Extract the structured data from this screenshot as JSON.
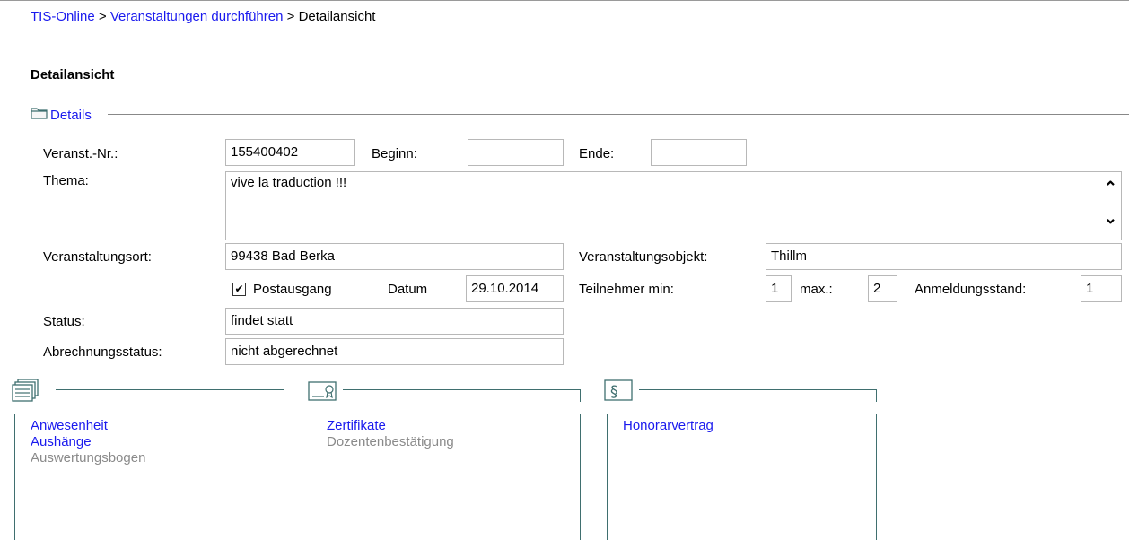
{
  "breadcrumb": {
    "items": [
      {
        "label": "TIS-Online",
        "link": true
      },
      {
        "label": "Veranstaltungen durchführen",
        "link": true
      },
      {
        "label": "Detailansicht",
        "link": false
      }
    ],
    "separator": " > "
  },
  "page": {
    "title": "Detailansicht"
  },
  "details": {
    "legend": "Details",
    "labels": {
      "nr": "Veranst.-Nr.:",
      "beginn": "Beginn:",
      "ende": "Ende:",
      "thema": "Thema:",
      "ort": "Veranstaltungsort:",
      "objekt": "Veranstaltungsobjekt:",
      "postausgang": "Postausgang",
      "datum": "Datum",
      "teilnehmer_min": "Teilnehmer min:",
      "max": "max.:",
      "anmeldungsstand": "Anmeldungsstand:",
      "status": "Status:",
      "abrechnungsstatus": "Abrechnungsstatus:"
    },
    "values": {
      "nr": "155400402",
      "beginn": "",
      "ende": "",
      "thema": "vive la traduction !!!",
      "ort": "99438 Bad Berka",
      "objekt": "Thillm",
      "postausgang_checked": true,
      "datum": "29.10.2014",
      "teilnehmer_min": "1",
      "max": "2",
      "anmeldungsstand": "1",
      "status": "findet statt",
      "abrechnungsstatus": "nicht abgerechnet"
    }
  },
  "panels": [
    {
      "icon": "documents-stack-icon",
      "items": [
        {
          "label": "Anwesenheit",
          "active": true
        },
        {
          "label": "Aushänge",
          "active": true
        },
        {
          "label": "Auswertungsbogen",
          "active": false
        }
      ]
    },
    {
      "icon": "certificate-icon",
      "items": [
        {
          "label": "Zertifikate",
          "active": true
        },
        {
          "label": "Dozentenbestätigung",
          "active": false
        }
      ]
    },
    {
      "icon": "paragraph-icon",
      "items": [
        {
          "label": "Honorarvertrag",
          "active": true
        }
      ]
    }
  ],
  "colors": {
    "link": "#1a1aee",
    "frame": "#3f6f6f",
    "disabled": "#8a8a8a"
  }
}
